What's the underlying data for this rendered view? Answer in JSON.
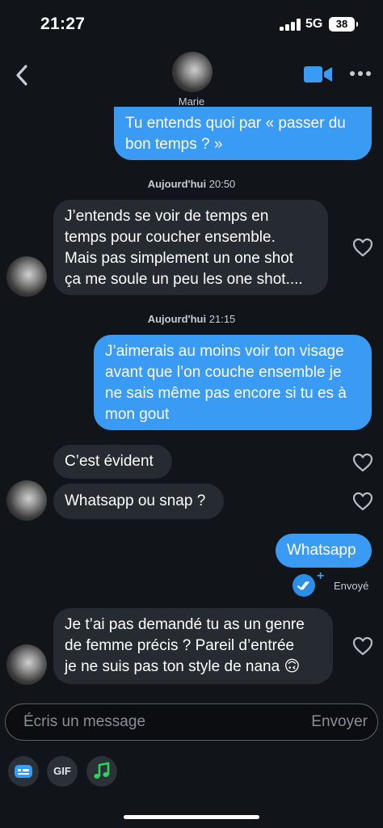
{
  "status_bar": {
    "time": "21:27",
    "network": "5G",
    "battery": "38"
  },
  "header": {
    "contact_name": "Marie"
  },
  "messages": [
    {
      "direction": "out",
      "lines": [
        "Tu entends quoi par « passer du",
        "bon temps ? »"
      ]
    },
    {
      "direction": "in",
      "lines": [
        "J’entends se voir de temps en",
        "temps pour coucher ensemble.",
        "Mais pas simplement un one shot",
        "ça me soule un peu les one shot...."
      ]
    },
    {
      "direction": "out",
      "lines": [
        "J’aimerais au moins voir ton visage",
        "avant que l’on couche ensemble je",
        "ne sais même pas encore si tu es à",
        "mon gout"
      ]
    },
    {
      "direction": "in",
      "lines": [
        "C’est évident"
      ]
    },
    {
      "direction": "in",
      "lines": [
        "Whatsapp ou snap ?"
      ]
    },
    {
      "direction": "out",
      "lines": [
        "Whatsapp"
      ]
    },
    {
      "direction": "in",
      "lines": [
        "Je t’ai pas demandé tu as un genre",
        "de femme précis ? Pareil d’entrée",
        "je ne suis pas ton style de nana 🙃"
      ]
    }
  ],
  "timestamps": [
    {
      "day": "Aujourd'hui",
      "time": "20:50"
    },
    {
      "day": "Aujourd'hui",
      "time": "21:15"
    }
  ],
  "delivery_status": "Envoyé",
  "composer": {
    "placeholder": "Écris un message",
    "send_label": "Envoyer"
  },
  "toolbar": {
    "gif_label": "GIF"
  },
  "icons": {
    "back": "chevron-left-icon",
    "video": "video-camera-icon",
    "more": "more-dots-icon",
    "like": "heart-outline-icon",
    "sent": "double-check-icon",
    "sticker": "sticker-icon",
    "music": "music-note-icon"
  },
  "colors": {
    "accent": "#3a9bf5",
    "background": "#111418",
    "incoming_bubble": "#262a31",
    "music_green": "#2fd05c"
  }
}
